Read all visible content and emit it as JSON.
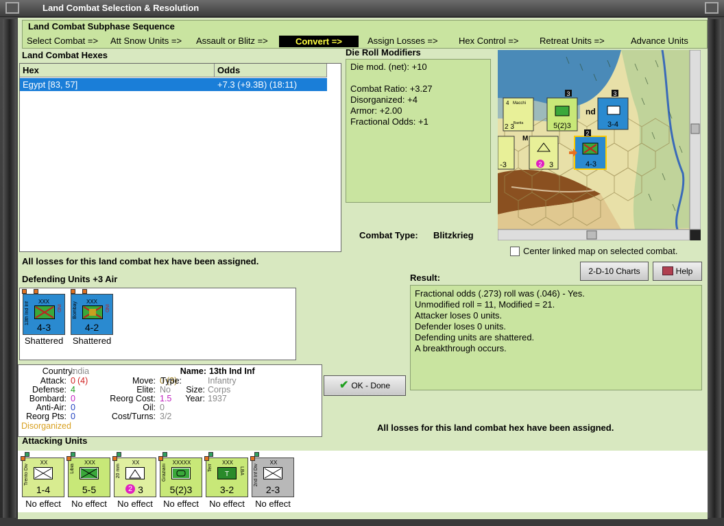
{
  "window": {
    "title": "Land Combat Selection & Resolution"
  },
  "subphase": {
    "title": "Land Combat Subphase Sequence",
    "steps": [
      "Select Combat =>",
      "Att Snow Units =>",
      "Assault or Blitz =>",
      "Convert =>",
      "Assign Losses =>",
      "Hex Control =>",
      "Retreat Units =>",
      "Advance Units"
    ],
    "active": "Convert =>"
  },
  "hexes": {
    "title": "Land Combat Hexes",
    "columns": [
      "Hex",
      "Odds"
    ],
    "rows": [
      {
        "hex": "Egypt [83, 57]",
        "odds": "+7.3 (+9.3B) (18:11)"
      }
    ]
  },
  "modifiers": {
    "title": "Die Roll Modifiers",
    "lines": [
      "Die mod. (net): +10",
      "Combat Ratio: +3.27",
      "Disorganized: +4",
      "Armor: +2.00",
      "Fractional Odds: +1"
    ]
  },
  "combat_type": {
    "label": "Combat Type:",
    "value": "Blitzkrieg"
  },
  "center_map": {
    "label": "Center linked map on selected combat.",
    "checked": false
  },
  "buttons": {
    "charts": "2-D-10 Charts",
    "help": "Help",
    "ok": "OK - Done"
  },
  "losses_msg": "All losses for this land combat hex have been assigned.",
  "defending": {
    "title": "Defending Units +3 Air",
    "units": [
      {
        "name": "13th Ind Inf",
        "tag": "IND",
        "size": "XXX",
        "strength": "4-3",
        "status": "Shattered"
      },
      {
        "name": "Bombay",
        "tag": "IND",
        "size": "XXX",
        "strength": "4-2",
        "status": "Shattered"
      }
    ]
  },
  "result": {
    "title": "Result:",
    "lines": [
      "Fractional odds (.273) roll was (.046)  - Yes.",
      "Unmodified roll = 11, Modified = 21.",
      "Attacker loses 0 units.",
      "Defender loses 0 units.",
      "Defending units are shattered.",
      "A breakthrough occurs."
    ]
  },
  "unit_info": {
    "country_k": "Country:",
    "country": "India",
    "attack_k": "Attack:",
    "attack": "0",
    "attack2": "(4)",
    "defense_k": "Defense:",
    "defense": "4",
    "bombard_k": "Bombard:",
    "bombard": "0",
    "antiair_k": "Anti-Air:",
    "antiair": "0",
    "reorgpts_k": "Reorg Pts:",
    "reorgpts": "0",
    "status": "Disorganized",
    "move_k": "Move:",
    "move": "0",
    "move2": "(3)",
    "elite_k": "Elite:",
    "elite": "No",
    "reorgcost_k": "Reorg Cost:",
    "reorgcost": "1.5",
    "oil_k": "Oil:",
    "oil": "0",
    "costturns_k": "Cost/Turns:",
    "costturns": "3/2",
    "name_k": "Name:",
    "name": "13th Ind Inf",
    "type_k": "Type:",
    "type": "Infantry",
    "size_k": "Size:",
    "size": "Corps",
    "year_k": "Year:",
    "year": "1937"
  },
  "attacking": {
    "title": "Attacking Units",
    "units": [
      {
        "name": "Trento Div",
        "size": "XX",
        "strength": "1-4",
        "status": "No effect",
        "color": "#d8ec90"
      },
      {
        "name": "Libia",
        "size": "XXX",
        "strength": "5-5",
        "status": "No effect",
        "color": "#c8e878"
      },
      {
        "name": "20 mm",
        "size": "XX",
        "strength": "3",
        "badge": "2",
        "status": "No effect",
        "color": "#e0f0a0"
      },
      {
        "name": "Graziani",
        "size": "XXXXX",
        "strength": "5(2)3",
        "status": "No effect",
        "color": "#c8e878"
      },
      {
        "name": "Terr",
        "tag": "LBA",
        "size": "XXX",
        "strength": "3-2",
        "status": "No effect",
        "color": "#c8e878"
      },
      {
        "name": "2nd Inf Div",
        "size": "XX",
        "strength": "2-3",
        "status": "No effect",
        "color": "#b8b8b8"
      }
    ]
  },
  "map": {
    "counters": [
      {
        "label": "Macchi C.200 Baetta",
        "values": "2 3",
        "top_num": "4"
      },
      {
        "label": "Graziani",
        "strength": "5(2)3",
        "stack": "3"
      },
      {
        "label": "",
        "strength": "3-4",
        "stack": "3"
      },
      {
        "label": "20 mm",
        "strength": "3",
        "badge": "2"
      },
      {
        "label": "13th Ind Inf",
        "strength": "4-3",
        "stack": "2"
      },
      {
        "label": "",
        "strength": "-3"
      }
    ],
    "letters": [
      "M",
      "nd"
    ]
  }
}
